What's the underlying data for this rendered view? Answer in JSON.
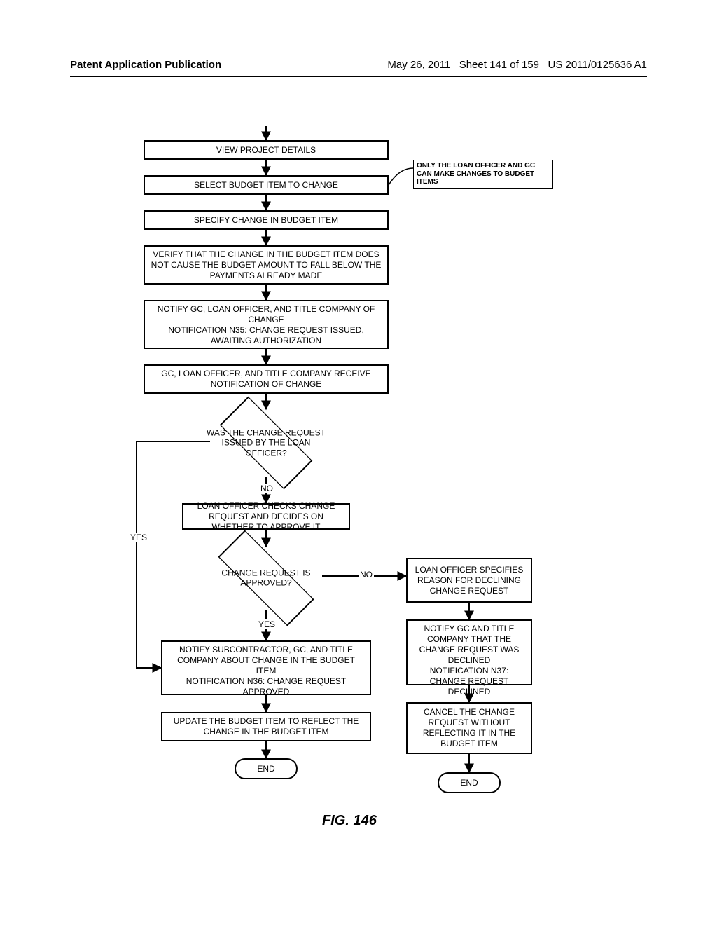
{
  "header": {
    "left": "Patent Application Publication",
    "date": "May 26, 2011",
    "sheet": "Sheet 141 of 159",
    "pubno": "US 2011/0125636 A1"
  },
  "note": "ONLY THE LOAN OFFICER AND GC CAN MAKE CHANGES TO BUDGET ITEMS",
  "boxes": {
    "b1": "VIEW PROJECT DETAILS",
    "b2": "SELECT BUDGET ITEM TO CHANGE",
    "b3": "SPECIFY CHANGE IN BUDGET ITEM",
    "b4": "VERIFY THAT THE CHANGE IN THE BUDGET ITEM DOES NOT CAUSE THE BUDGET AMOUNT TO FALL BELOW THE PAYMENTS ALREADY MADE",
    "b5a": "NOTIFY GC, LOAN OFFICER, AND TITLE COMPANY OF CHANGE",
    "b5b": "NOTIFICATION N35: CHANGE REQUEST ISSUED, AWAITING AUTHORIZATION",
    "b6": "GC, LOAN OFFICER, AND TITLE COMPANY RECEIVE NOTIFICATION OF CHANGE",
    "d1": "WAS THE CHANGE REQUEST ISSUED BY THE LOAN OFFICER?",
    "b7": "LOAN OFFICER CHECKS CHANGE REQUEST AND DECIDES ON WHETHER TO APPROVE IT",
    "d2": "CHANGE REQUEST IS APPROVED?",
    "b8a": "NOTIFY SUBCONTRACTOR, GC, AND TITLE COMPANY ABOUT CHANGE IN THE BUDGET ITEM",
    "b8b": "NOTIFICATION N36: CHANGE REQUEST APPROVED",
    "b9": "UPDATE THE BUDGET ITEM TO REFLECT THE CHANGE IN THE BUDGET ITEM",
    "end1": "END",
    "r1": "LOAN OFFICER SPECIFIES REASON FOR DECLINING CHANGE REQUEST",
    "r2a": "NOTIFY GC AND TITLE COMPANY THAT THE CHANGE REQUEST WAS DECLINED",
    "r2b": "NOTIFICATION N37: CHANGE REQUEST DECLINED",
    "r3": "CANCEL THE CHANGE REQUEST WITHOUT REFLECTING IT IN THE BUDGET ITEM",
    "end2": "END"
  },
  "labels": {
    "yes1": "YES",
    "no1": "NO",
    "yes2": "YES",
    "no2": "NO"
  },
  "figure": "FIG. 146"
}
